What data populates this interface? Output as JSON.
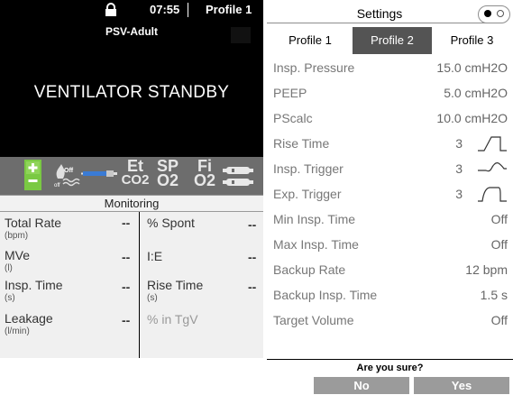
{
  "topbar": {
    "time": "07:55",
    "profile": "Profile 1"
  },
  "mode": "PSV-Adult",
  "status": "VENTILATOR STANDBY",
  "gas_icons": {
    "battery_label": "+",
    "o2_state": "Off",
    "o2_state2": "off",
    "et": "Et",
    "co2": "CO2",
    "sp": "SP",
    "sp_o2": "O2",
    "fi": "Fi",
    "fi_o2": "O2"
  },
  "monitoring": {
    "title": "Monitoring",
    "left": [
      {
        "label": "Total Rate",
        "unit": "(bpm)",
        "value": "--"
      },
      {
        "label": "MVe",
        "unit": "(l)",
        "value": "--"
      },
      {
        "label": "Insp. Time",
        "unit": "(s)",
        "value": "--"
      },
      {
        "label": "Leakage",
        "unit": "(l/min)",
        "value": "--"
      }
    ],
    "right": [
      {
        "label": "% Spont",
        "unit": "",
        "value": "--"
      },
      {
        "label": "I:E",
        "unit": "",
        "value": "--"
      },
      {
        "label": "Rise Time",
        "unit": "(s)",
        "value": "--"
      },
      {
        "label": "% in TgV",
        "unit": "",
        "value": ""
      }
    ]
  },
  "settings": {
    "title": "Settings",
    "tabs": [
      "Profile 1",
      "Profile 2",
      "Profile 3"
    ],
    "active_tab": "Profile 2",
    "rows": [
      {
        "label": "Insp. Pressure",
        "value": "15.0 cmH2O"
      },
      {
        "label": "PEEP",
        "value": "5.0 cmH2O"
      },
      {
        "label": "PScalc",
        "value": "10.0 cmH2O"
      },
      {
        "label": "Rise Time",
        "value": "3",
        "curve": "rise"
      },
      {
        "label": "Insp. Trigger",
        "value": "3",
        "curve": "trigger"
      },
      {
        "label": "Exp. Trigger",
        "value": "3",
        "curve": "exp"
      },
      {
        "label": "Min Insp. Time",
        "value": "Off"
      },
      {
        "label": "Max Insp. Time",
        "value": "Off"
      },
      {
        "label": "Backup Rate",
        "value": "12 bpm"
      },
      {
        "label": "Backup Insp. Time",
        "value": "1.5 s"
      },
      {
        "label": "Target Volume",
        "value": "Off"
      }
    ]
  },
  "confirm": {
    "question": "Are you sure?",
    "no": "No",
    "yes": "Yes"
  },
  "colors": {
    "topbar": "#000000",
    "icon_bar": "#6d6d6d",
    "battery": "#7ac943",
    "active_tab": "#545454",
    "confirm_button": "#9b9b9b"
  }
}
